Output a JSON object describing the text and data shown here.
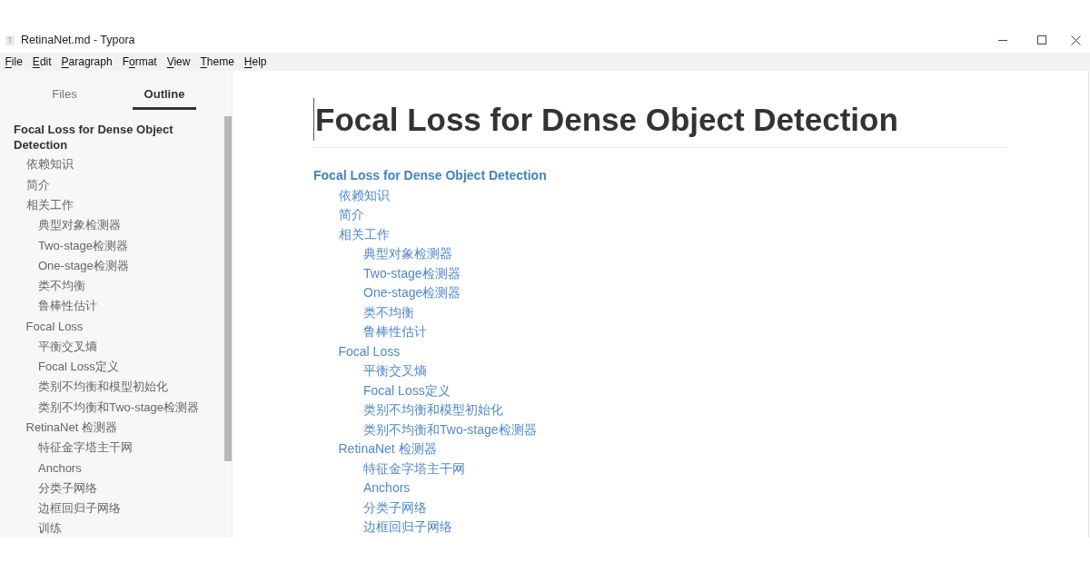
{
  "window": {
    "icon_letter": "T",
    "title": "RetinaNet.md - Typora"
  },
  "menu": [
    {
      "mnemonic": "F",
      "after": "ile"
    },
    {
      "mnemonic": "E",
      "after": "dit"
    },
    {
      "mnemonic": "P",
      "after": "aragraph"
    },
    {
      "before": "F",
      "mnemonic": "o",
      "after": "rmat"
    },
    {
      "mnemonic": "V",
      "after": "iew"
    },
    {
      "mnemonic": "T",
      "after": "heme"
    },
    {
      "mnemonic": "H",
      "after": "elp"
    }
  ],
  "sidebar": {
    "tabs": [
      {
        "label": "Files",
        "selected": false
      },
      {
        "label": "Outline",
        "selected": true
      }
    ],
    "outline": [
      {
        "label": "Focal Loss for Dense Object Detection",
        "children": [
          {
            "label": "依赖知识"
          },
          {
            "label": "简介"
          },
          {
            "label": "相关工作",
            "children": [
              {
                "label": "典型对象检测器"
              },
              {
                "label": "Two-stage检测器"
              },
              {
                "label": "One-stage检测器"
              },
              {
                "label": "类不均衡"
              },
              {
                "label": "鲁棒性估计"
              }
            ]
          },
          {
            "label": "Focal Loss",
            "children": [
              {
                "label": "平衡交叉熵"
              },
              {
                "label": "Focal Loss定义"
              },
              {
                "label": "类别不均衡和模型初始化"
              },
              {
                "label": "类别不均衡和Two-stage检测器"
              }
            ]
          },
          {
            "label": "RetinaNet 检测器",
            "children": [
              {
                "label": "特征金字塔主干网"
              },
              {
                "label": "Anchors"
              },
              {
                "label": "分类子网络"
              },
              {
                "label": "边框回归子网络"
              },
              {
                "label": "训练"
              }
            ]
          }
        ]
      }
    ]
  },
  "document": {
    "heading": "Focal Loss for Dense Object Detection",
    "toc": [
      {
        "label": "Focal Loss for Dense Object Detection",
        "children": [
          {
            "label": "依赖知识"
          },
          {
            "label": "简介"
          },
          {
            "label": "相关工作",
            "children": [
              {
                "label": "典型对象检测器"
              },
              {
                "label": "Two-stage检测器"
              },
              {
                "label": "One-stage检测器"
              },
              {
                "label": "类不均衡"
              },
              {
                "label": "鲁棒性估计"
              }
            ]
          },
          {
            "label": "Focal Loss",
            "children": [
              {
                "label": "平衡交叉熵"
              },
              {
                "label": "Focal Loss定义"
              },
              {
                "label": "类别不均衡和模型初始化"
              },
              {
                "label": "类别不均衡和Two-stage检测器"
              }
            ]
          },
          {
            "label": "RetinaNet 检测器",
            "children": [
              {
                "label": "特征金字塔主干网"
              },
              {
                "label": "Anchors"
              },
              {
                "label": "分类子网络"
              },
              {
                "label": "边框回归子网络"
              }
            ]
          }
        ]
      }
    ]
  }
}
